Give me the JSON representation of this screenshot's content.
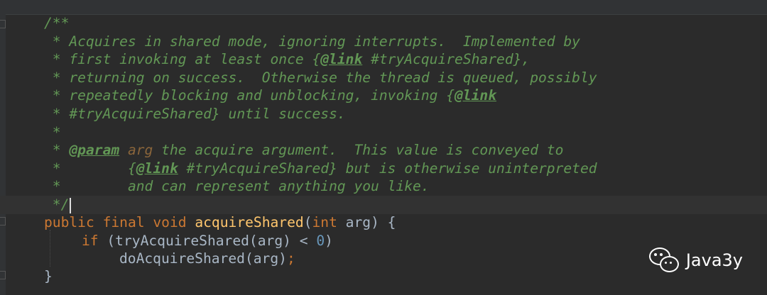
{
  "doc_comment": {
    "l1": "/**",
    "l2": " * Acquires in shared mode, ignoring interrupts.  Implemented by",
    "l3_a": " * first invoking at least once {",
    "l3_tag": "@link",
    "l3_b": " #tryAcquireShared},",
    "l4": " * returning on success.  Otherwise the thread is queued, possibly",
    "l5_a": " * repeatedly blocking and unblocking, invoking {",
    "l5_tag": "@link",
    "l6": " * #tryAcquireShared} until success.",
    "l7": " *",
    "l8_a": " * ",
    "l8_tag": "@param",
    "l8_param": " arg",
    "l8_b": " the acquire argument.  This value is conveyed to",
    "l9_a": " *        {",
    "l9_tag": "@link",
    "l9_b": " #tryAcquireShared} but is otherwise uninterpreted",
    "l10": " *        and can represent anything you like.",
    "l11": " */"
  },
  "code": {
    "kw_public": "public",
    "kw_final": "final",
    "kw_void": "void",
    "method": "acquireShared",
    "open_paren": "(",
    "kw_int": "int",
    "sig_rest": " arg) {",
    "kw_if": "if",
    "if_body": " (tryAcquireShared(arg) < ",
    "zero": "0",
    "if_close": ")",
    "call": "doAcquireShared(arg)",
    "semicolon": ";",
    "close_brace": "}"
  },
  "watermark": {
    "icon": "wechat-icon",
    "text": "Java3y"
  },
  "colors": {
    "background": "#2b2b2b",
    "doc_comment": "#629755",
    "keyword": "#cc7832",
    "method_name": "#ffc66d",
    "number": "#6897bb",
    "plain": "#a9b7c6"
  }
}
